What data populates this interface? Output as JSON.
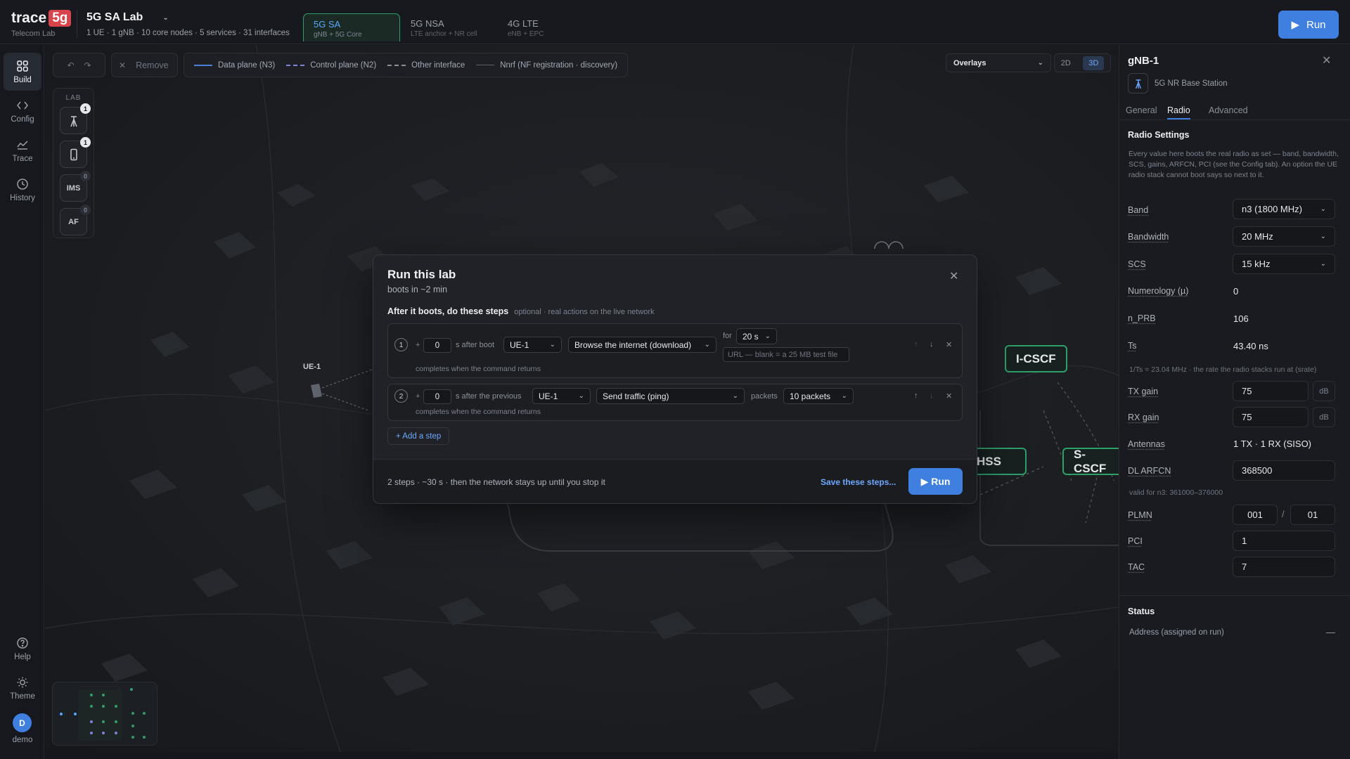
{
  "app": {
    "brand": "trace",
    "brand_badge": "5g",
    "brand_sub": "Telecom Lab"
  },
  "lab": {
    "title": "5G SA Lab",
    "summary": "1 UE · 1 gNB · 10 core nodes · 5 services · 31 interfaces"
  },
  "mode_tabs": [
    {
      "label": "5G SA",
      "sub": "gNB + 5G Core",
      "active": true
    },
    {
      "label": "5G NSA",
      "sub": "LTE anchor + NR cell",
      "active": false
    },
    {
      "label": "4G LTE",
      "sub": "eNB + EPC",
      "active": false
    }
  ],
  "top_run": {
    "label": "Run"
  },
  "rail": {
    "items": [
      {
        "label": "Build",
        "icon": "grid-icon",
        "active": true
      },
      {
        "label": "Config",
        "icon": "code-icon",
        "active": false
      },
      {
        "label": "Trace",
        "icon": "chart-icon",
        "active": false
      },
      {
        "label": "History",
        "icon": "clock-icon",
        "active": false
      }
    ],
    "bottom": [
      {
        "label": "Help",
        "icon": "help-icon"
      },
      {
        "label": "Theme",
        "icon": "sun-icon"
      }
    ],
    "user": {
      "initial": "D",
      "label": "demo"
    }
  },
  "toolbar": {
    "remove_label": "Remove",
    "legend": [
      {
        "label": "Data plane (N3)",
        "style": "solid"
      },
      {
        "label": "Control plane (N2)",
        "style": "dashed"
      },
      {
        "label": "Other interface",
        "style": "dashed2"
      },
      {
        "label": "Nnrf (NF registration · discovery)",
        "style": "thin"
      }
    ],
    "overlays_label": "Overlays",
    "view_2d": "2D",
    "view_3d": "3D"
  },
  "palette": {
    "title": "LAB",
    "items": [
      {
        "kind": "gnb",
        "count": "1"
      },
      {
        "kind": "ue",
        "count": "1"
      },
      {
        "kind": "text",
        "label": "IMS",
        "count": "0"
      },
      {
        "kind": "text",
        "label": "AF",
        "count": "0"
      }
    ]
  },
  "canvas": {
    "ue_label": "UE-1",
    "nodes": {
      "icscf": "I-CSCF",
      "hss": "HSS",
      "scscf": "S-CSCF"
    }
  },
  "modal": {
    "title": "Run this lab",
    "subtitle": "boots in ~2 min",
    "steps_heading": "After it boots, do these steps",
    "steps_optional": "optional · real actions on the live network",
    "steps": [
      {
        "num": "1",
        "delay": "0",
        "delay_text": "s after boot",
        "target": "UE-1",
        "action": "Browse the internet (download)",
        "for_label": "for",
        "duration": "20 s",
        "url_placeholder": "URL — blank = a 25 MB test file",
        "note": "completes when the command returns"
      },
      {
        "num": "2",
        "delay": "0",
        "delay_text": "s after the previous",
        "target": "UE-1",
        "action": "Send traffic (ping)",
        "packets_label": "packets",
        "packets": "10 packets",
        "note": "completes when the command returns"
      }
    ],
    "add_step": "+ Add a step",
    "summary": "2 steps · ~30 s · then the network stays up until you stop it",
    "save": "Save these steps...",
    "run": "▶ Run"
  },
  "panel": {
    "title": "gNB-1",
    "type": "5G NR Base Station",
    "tabs": [
      "General",
      "Radio",
      "Advanced"
    ],
    "active_tab": "Radio",
    "section": "Radio Settings",
    "help": "Every value here boots the real radio as set — band, bandwidth, SCS, gains, ARFCN, PCI (see the Config tab). An option the UE radio stack cannot boot says so next to it.",
    "fields": {
      "band": {
        "label": "Band",
        "value": "n3 (1800 MHz)"
      },
      "bandwidth": {
        "label": "Bandwidth",
        "value": "20 MHz"
      },
      "scs": {
        "label": "SCS",
        "value": "15 kHz"
      },
      "numerology": {
        "label": "Numerology (µ)",
        "value": "0"
      },
      "nprb": {
        "label": "n_PRB",
        "value": "106"
      },
      "ts": {
        "label": "Ts",
        "value": "43.40 ns",
        "note": "1/Ts = 23.04 MHz · the rate the radio stacks run at (srate)"
      },
      "tx_gain": {
        "label": "TX gain",
        "value": "75",
        "unit": "dB"
      },
      "rx_gain": {
        "label": "RX gain",
        "value": "75",
        "unit": "dB"
      },
      "antennas": {
        "label": "Antennas",
        "value": "1 TX · 1 RX (SISO)"
      },
      "dl_arfcn": {
        "label": "DL ARFCN",
        "value": "368500",
        "note": "valid for n3: 361000–376000"
      },
      "plmn": {
        "label": "PLMN",
        "mcc": "001",
        "sep": "/",
        "mnc": "01"
      },
      "pci": {
        "label": "PCI",
        "value": "1"
      },
      "tac": {
        "label": "TAC",
        "value": "7"
      }
    },
    "status": {
      "heading": "Status",
      "address_label": "Address (assigned on run)",
      "address_value": "—"
    }
  },
  "colors": {
    "accent": "#3f7fe0",
    "node_border": "#2f9f6a",
    "brand_badge": "#d9434c"
  }
}
